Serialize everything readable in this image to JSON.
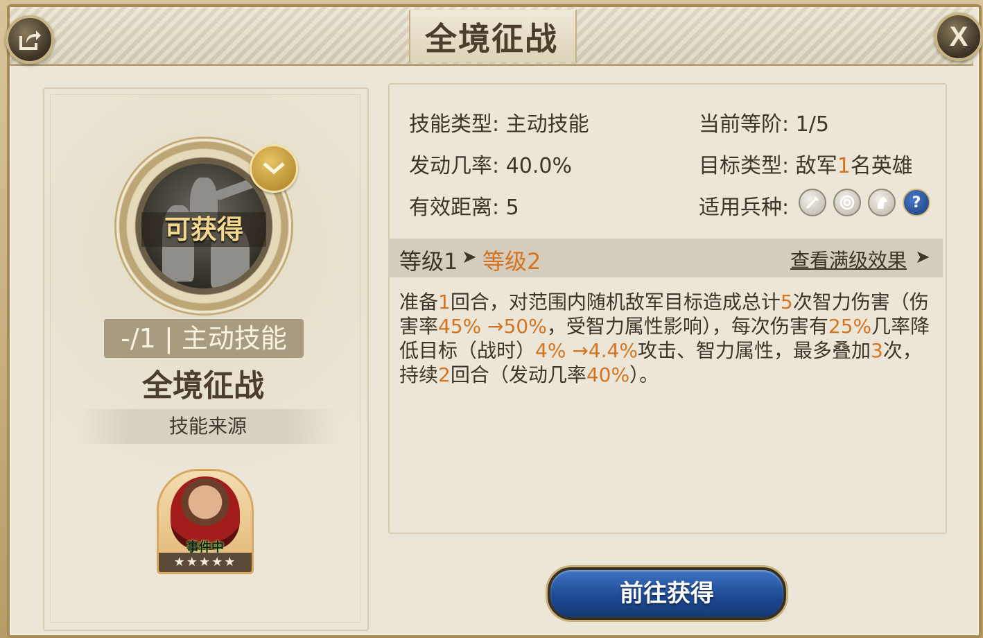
{
  "window": {
    "title": "全境征战",
    "close_label": "X"
  },
  "left": {
    "medal_label": "可获得",
    "level_tag": "-/1 | 主动技能",
    "skill_name": "全境征战",
    "source_label": "技能来源",
    "hero": {
      "status": "事件中",
      "stars": "★★★★★"
    }
  },
  "info": {
    "skill_type_label": "技能类型:",
    "skill_type_value": "主动技能",
    "current_rank_label": "当前等阶:",
    "current_rank_value": "1/5",
    "trigger_rate_label": "发动几率:",
    "trigger_rate_value": "40.0%",
    "target_type_label": "目标类型:",
    "target_type_prefix": "敌军",
    "target_type_num": "1",
    "target_type_suffix": "名英雄",
    "range_label": "有效距离:",
    "range_value": "5",
    "troops_label": "适用兵种:",
    "troops": [
      "sword-icon",
      "target-icon",
      "horse-icon",
      "question-icon"
    ]
  },
  "levels": {
    "from": "等级1",
    "arrow": "➤",
    "to": "等级2",
    "full_effect": "查看满级效果",
    "full_arrow": "➤"
  },
  "description": {
    "p1": "准备",
    "n1": "1",
    "p2": "回合，对范围内随机敌军目标造成总计",
    "n2": "5",
    "p3": "次智力伤害（伤害率",
    "n3": "45% →50%",
    "p4": "，受智力属性影响），每次伤害有",
    "n4": "25%",
    "p5": "几率降低目标（战时）",
    "n5": "4% →4.4%",
    "p6": "攻击、智力属性，最多叠加",
    "n6": "3",
    "p7": "次，持续",
    "n7": "2",
    "p8": "回合（发动几率",
    "n8": "40%",
    "p9": "）。"
  },
  "actions": {
    "goto_label": "前往获得"
  }
}
